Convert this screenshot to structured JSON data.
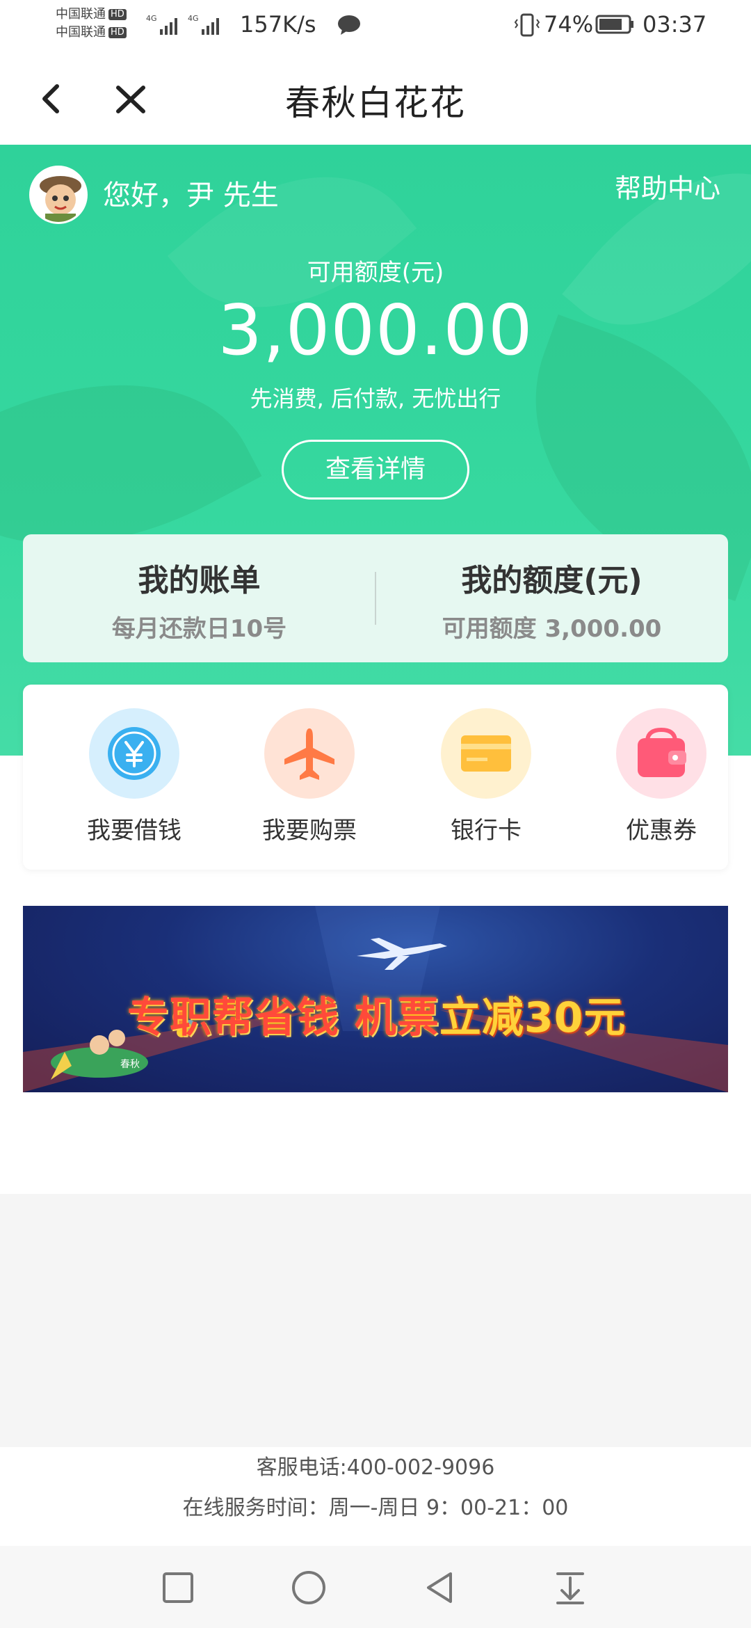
{
  "status_bar": {
    "carrier1": "中国联通",
    "carrier2": "中国联通",
    "hd_label": "HD",
    "net1": "4G",
    "net2": "4G",
    "speed": "157K/s",
    "battery": "74%",
    "time": "03:37"
  },
  "navbar": {
    "title": "春秋白花花"
  },
  "hero": {
    "greeting": "您好，尹 先生",
    "help": "帮助中心",
    "available_label": "可用额度(元)",
    "available_amount": "3,000.00",
    "slogan": "先消费, 后付款, 无忧出行",
    "detail_button": "查看详情"
  },
  "bill_card": {
    "bill_title": "我的账单",
    "bill_sub": "每月还款日10号",
    "quota_title": "我的额度(元)",
    "quota_sub": "可用额度 3,000.00"
  },
  "services": [
    {
      "label": "我要借钱",
      "icon": "yuan-coin-icon",
      "color": "#3ab0f0",
      "bg": "#d6effd"
    },
    {
      "label": "我要购票",
      "icon": "airplane-icon",
      "color": "#ff7a45",
      "bg": "#ffe3d6"
    },
    {
      "label": "银行卡",
      "icon": "bank-card-icon",
      "color": "#ffbf3c",
      "bg": "#fff1cf"
    },
    {
      "label": "优惠券",
      "icon": "wallet-icon",
      "color": "#ff5a78",
      "bg": "#ffe0e6"
    }
  ],
  "banner": {
    "text_a": "专职帮省钱 机票",
    "text_b": "立减30元",
    "plane_tag": "春秋"
  },
  "footer": {
    "phone": "客服电话:400-002-9096",
    "hours": "在线服务时间：周一-周日 9：00-21：00"
  }
}
